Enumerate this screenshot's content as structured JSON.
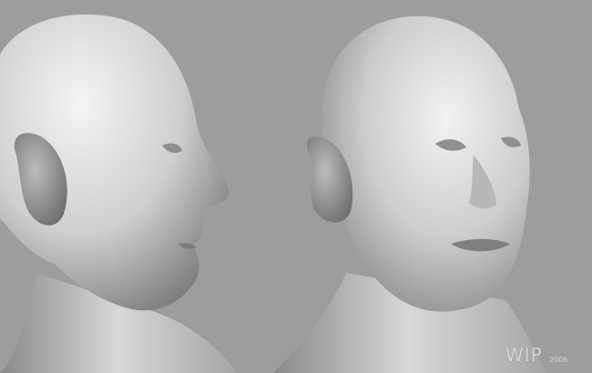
{
  "watermark": {
    "label": "WIP",
    "year": "2006"
  },
  "colors": {
    "background": "#9d9d9d",
    "clay_light": "#efefef",
    "clay_mid": "#c9c9c9",
    "clay_dark": "#6f6f6f"
  },
  "subjects": [
    {
      "name": "sculpt-head-profile",
      "view": "profile"
    },
    {
      "name": "sculpt-head-three-quarter",
      "view": "three-quarter"
    }
  ]
}
